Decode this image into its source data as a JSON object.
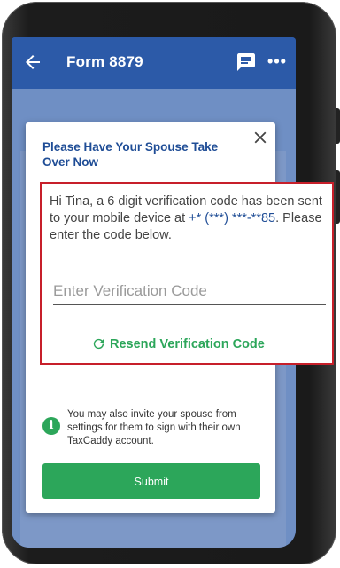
{
  "appbar": {
    "title": "Form 8879",
    "back_icon": "arrow-left-icon",
    "chat_icon": "message-icon",
    "more_icon": "more-horizontal-icon",
    "more_glyph": "•••",
    "color": "#2c5aa8"
  },
  "background_doc": {
    "form_label": "8879"
  },
  "modal": {
    "title": "Please Have Your Spouse Take Over Now",
    "close_icon": "close-icon",
    "info_icon_glyph": "i",
    "info_text": "You may also invite your spouse from settings for them to sign with their own TaxCaddy account.",
    "submit_label": "Submit"
  },
  "verification": {
    "message_prefix": "Hi Tina, a 6 digit verification code has been sent to your mobile device at ",
    "phone_masked": "+* (***) ***-**85",
    "message_suffix": ". Please enter the code below.",
    "input_value": "",
    "input_placeholder": "Enter Verification Code",
    "resend_label": "Resend Verification Code",
    "resend_icon": "refresh-icon"
  },
  "colors": {
    "brand_blue": "#1f4d96",
    "action_green": "#2ca65a",
    "highlight_red": "#c71f2a"
  }
}
